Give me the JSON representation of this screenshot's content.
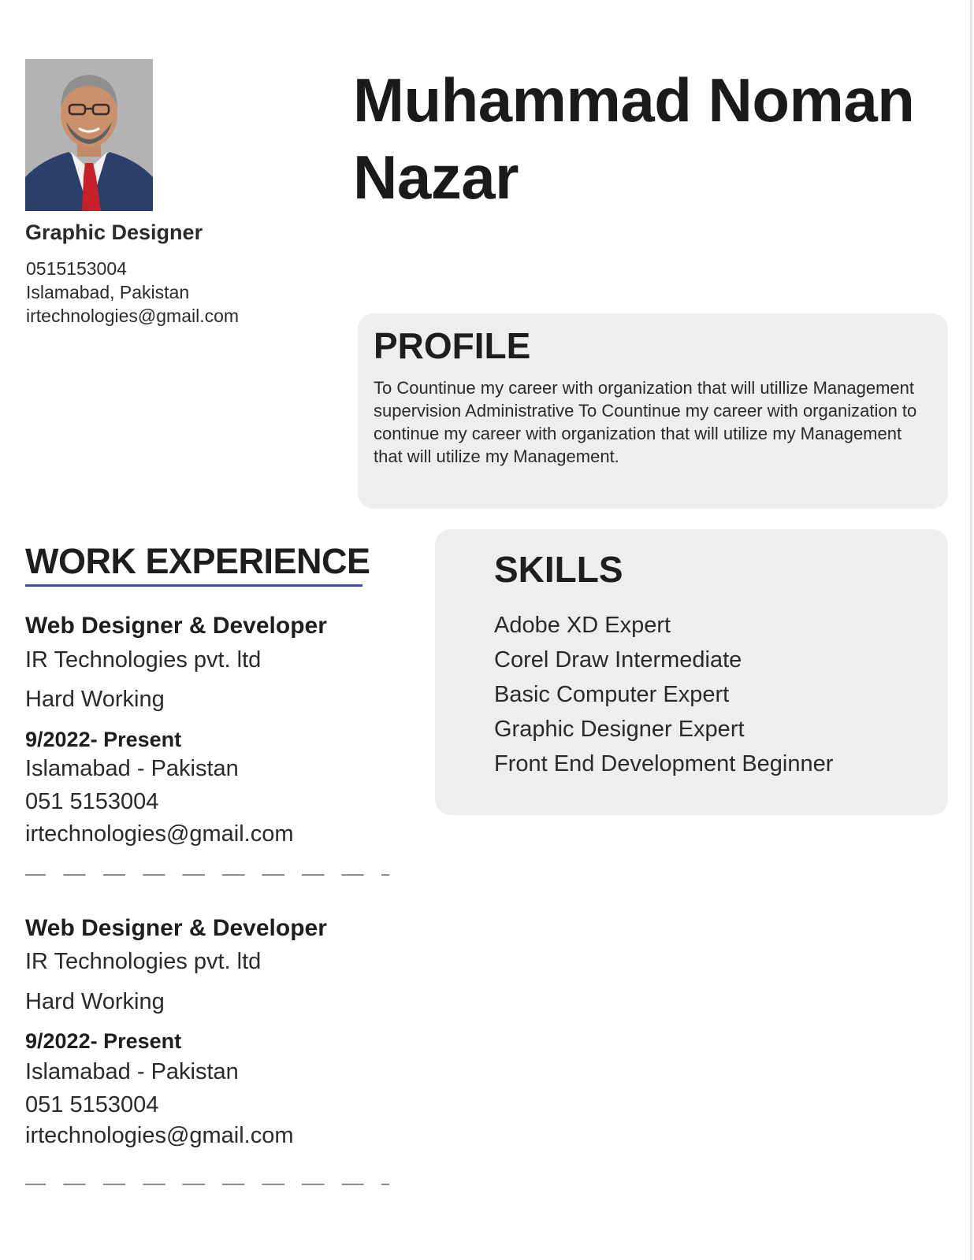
{
  "header": {
    "name_line1": "Muhammad Noman",
    "name_line2": "Nazar"
  },
  "sidebar": {
    "job_title": "Graphic Designer",
    "phone": "0515153004",
    "location": "Islamabad, Pakistan",
    "email": "irtechnologies@gmail.com"
  },
  "profile": {
    "heading": "PROFILE",
    "text": "To Countinue my career with organization that will utillize  Management supervision Administrative To Countinue my career with organization to continue my career with organization that will utilize my Management that will utilize my Management."
  },
  "work": {
    "heading": "WORK EXPERIENCE",
    "jobs": [
      {
        "role": "Web Designer & Developer",
        "company": "IR Technologies pvt. ltd",
        "trait": "Hard Working",
        "date": "9/2022- Present",
        "location": "Islamabad - Pakistan",
        "phone": "051 5153004",
        "email": "irtechnologies@gmail.com"
      },
      {
        "role": "Web Designer & Developer",
        "company": "IR Technologies pvt. ltd",
        "trait": "Hard Working",
        "date": "9/2022- Present",
        "location": "Islamabad - Pakistan",
        "phone": "051 5153004",
        "email": "irtechnologies@gmail.com"
      }
    ]
  },
  "skills": {
    "heading": "SKILLS",
    "items": [
      "Adobe XD Expert",
      "Corel Draw Intermediate",
      "Basic Computer Expert",
      "Graphic Designer Expert",
      "Front End Development Beginner"
    ]
  },
  "colors": {
    "accent_underline": "#3d4aa8",
    "card_background": "#eeeeee",
    "text": "#2a2a2a"
  }
}
